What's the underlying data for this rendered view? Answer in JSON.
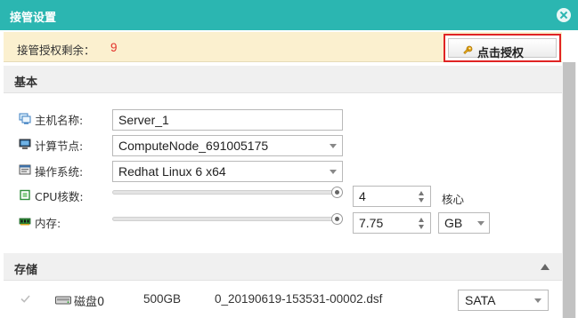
{
  "dialog": {
    "title": "接管设置"
  },
  "banner": {
    "label": "接管授权剩余：",
    "remaining": "9",
    "auth_button": "点击授权"
  },
  "basic": {
    "heading": "基本",
    "hostname": {
      "label": "主机名称:",
      "value": "Server_1"
    },
    "compute_node": {
      "label": "计算节点:",
      "value": "ComputeNode_691005175"
    },
    "os": {
      "label": "操作系统:",
      "value": "Redhat Linux 6 x64"
    },
    "cpu": {
      "label": "CPU核数:",
      "value": "4",
      "unit": "核心",
      "slider_fraction": 1.0
    },
    "memory": {
      "label": "内存:",
      "value": "7.75",
      "unit": "GB",
      "slider_fraction": 1.0
    }
  },
  "storage": {
    "heading": "存储",
    "disks": [
      {
        "name": "磁盘0",
        "size": "500GB",
        "file": "0_20190619-153531-00002.dsf",
        "bus": "SATA",
        "checked": true
      }
    ]
  },
  "colors": {
    "titlebar": "#2bb6b1",
    "banner": "#fbf0cf",
    "remaining": "#e3322b",
    "highlight_border": "#e02424"
  }
}
